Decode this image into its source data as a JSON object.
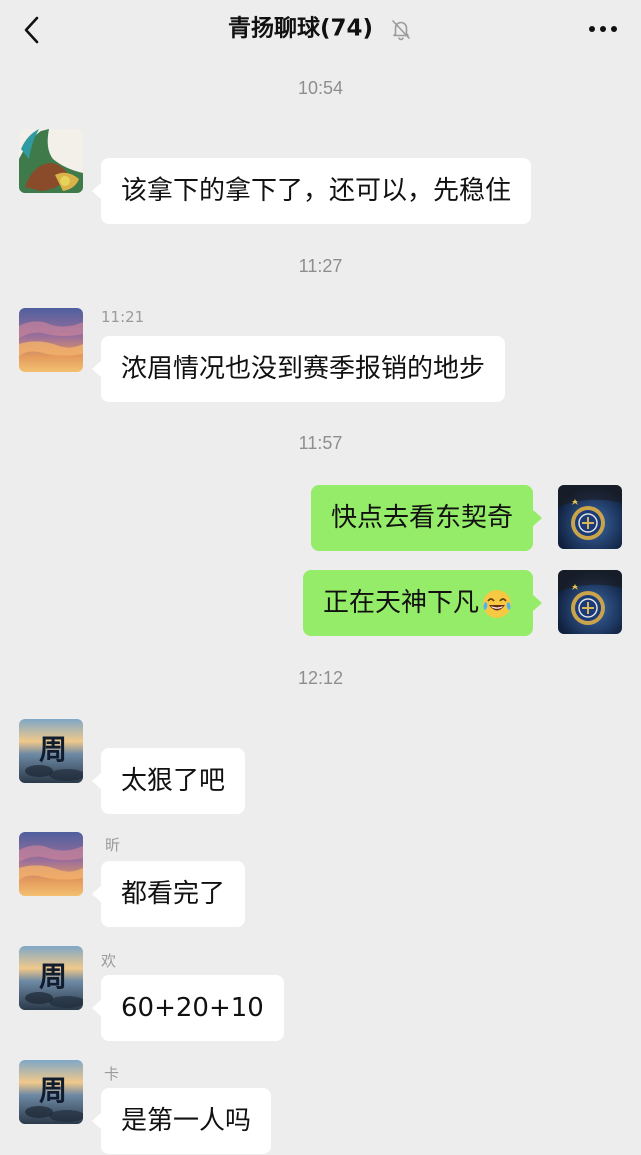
{
  "header": {
    "title": "青扬聊球(74)",
    "back_icon": "chevron-left-icon",
    "mute_icon": "bell-off-icon",
    "more_icon": "more-dots-icon"
  },
  "timestamps": [
    "10:54",
    "11:27",
    "11:57",
    "12:12"
  ],
  "messages": [
    {
      "side": "in",
      "avatar": "painting-avatar",
      "text": "该拿下的拿下了，还可以，先稳住"
    },
    {
      "side": "in",
      "avatar": "sunset-avatar",
      "sender": "11:21",
      "text": "浓眉情况也没到赛季报销的地步"
    },
    {
      "side": "out",
      "avatar": "inter-logo-avatar",
      "text": "快点去看东契奇"
    },
    {
      "side": "out",
      "avatar": "inter-logo-avatar",
      "text": "正在天神下凡",
      "emoji": "laughing-tears-emoji"
    },
    {
      "side": "in",
      "avatar": "zhou-avatar",
      "text": "太狠了吧"
    },
    {
      "side": "in",
      "avatar": "sunset-avatar",
      "sender": "昕",
      "text": "都看完了"
    },
    {
      "side": "in",
      "avatar": "zhou-avatar",
      "sender": "欢",
      "text": "60+20+10"
    },
    {
      "side": "in",
      "avatar": "zhou-avatar",
      "sender": "卡",
      "text": "是第一人吗"
    }
  ],
  "colors": {
    "background": "#ededed",
    "incoming_bubble": "#ffffff",
    "outgoing_bubble": "#95ec69",
    "timestamp": "#8e8e8e"
  }
}
